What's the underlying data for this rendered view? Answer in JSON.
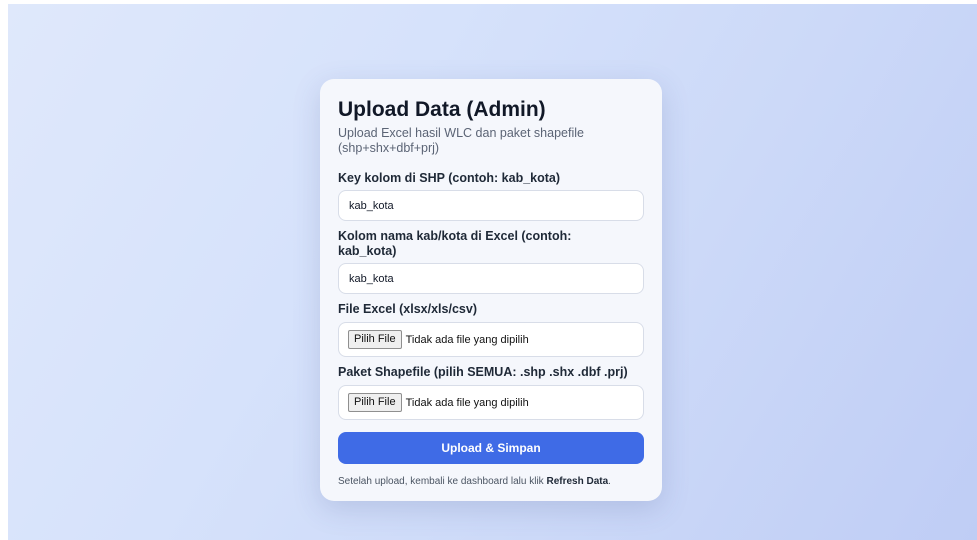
{
  "page": {
    "title": "Upload Data (Admin)",
    "subtitle": "Upload Excel hasil WLC dan paket shapefile (shp+shx+dbf+prj)"
  },
  "form": {
    "shp_key": {
      "label": "Key kolom di SHP (contoh: kab_kota)",
      "value": "kab_kota"
    },
    "excel_key": {
      "label": "Kolom nama kab/kota di Excel (contoh: kab_kota)",
      "value": "kab_kota"
    },
    "excel_file": {
      "label": "File Excel (xlsx/xls/csv)",
      "button_label": "Pilih File",
      "status": "Tidak ada file yang dipilih"
    },
    "shapefile": {
      "label": "Paket Shapefile (pilih SEMUA: .shp .shx .dbf .prj)",
      "button_label": "Pilih File",
      "status": "Tidak ada file yang dipilih"
    },
    "submit_label": "Upload & Simpan"
  },
  "footer": {
    "text_before": "Setelah upload, kembali ke dashboard lalu klik ",
    "text_bold": "Refresh Data",
    "text_after": "."
  },
  "colors": {
    "accent": "#3f6be6",
    "card_bg": "#f5f7fc",
    "page_bg": "#d6e2fb"
  }
}
